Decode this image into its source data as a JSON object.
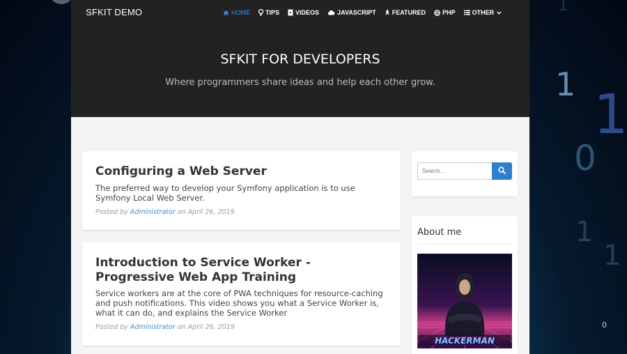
{
  "navbar": {
    "brand": "SFKIT DEMO",
    "items": [
      {
        "label": "HOME",
        "icon": "home-icon",
        "active": true
      },
      {
        "label": "TIPS",
        "icon": "lightbulb-icon"
      },
      {
        "label": "VIDEOS",
        "icon": "file-video-icon"
      },
      {
        "label": "JAVASCRIPT",
        "icon": "cloud-icon"
      },
      {
        "label": "FEATURED",
        "icon": "rocket-icon"
      },
      {
        "label": "PHP",
        "icon": "globe-icon"
      },
      {
        "label": "OTHER",
        "icon": "list-icon",
        "dropdown": true
      }
    ]
  },
  "hero": {
    "title": "SFKIT FOR DEVELOPERS",
    "subtitle": "Where programmers share ideas and help each other grow."
  },
  "posts": [
    {
      "title": "Configuring a Web Server",
      "excerpt": "The preferred way to develop your Symfony application is to use Symfony Local Web Server.",
      "posted_by": "Posted by",
      "author": "Administrator",
      "date": "on April 26, 2019"
    },
    {
      "title": "Introduction to Service Worker - Progressive Web App Training",
      "excerpt": "Service workers are at the core of PWA techniques for resource-caching and push notifications. This video shows you what a Service Worker is, what it can do, and explains the Service Worker",
      "posted_by": "Posted by",
      "author": "Administrator",
      "date": "on April 26, 2019"
    }
  ],
  "sidebar": {
    "search_placeholder": "Search...",
    "about_title": "About me",
    "about_image_caption": "HACKERMAN"
  },
  "colors": {
    "accent": "#3b8fd9",
    "navbar_bg": "#222222",
    "search_button": "#2f7fd1"
  }
}
